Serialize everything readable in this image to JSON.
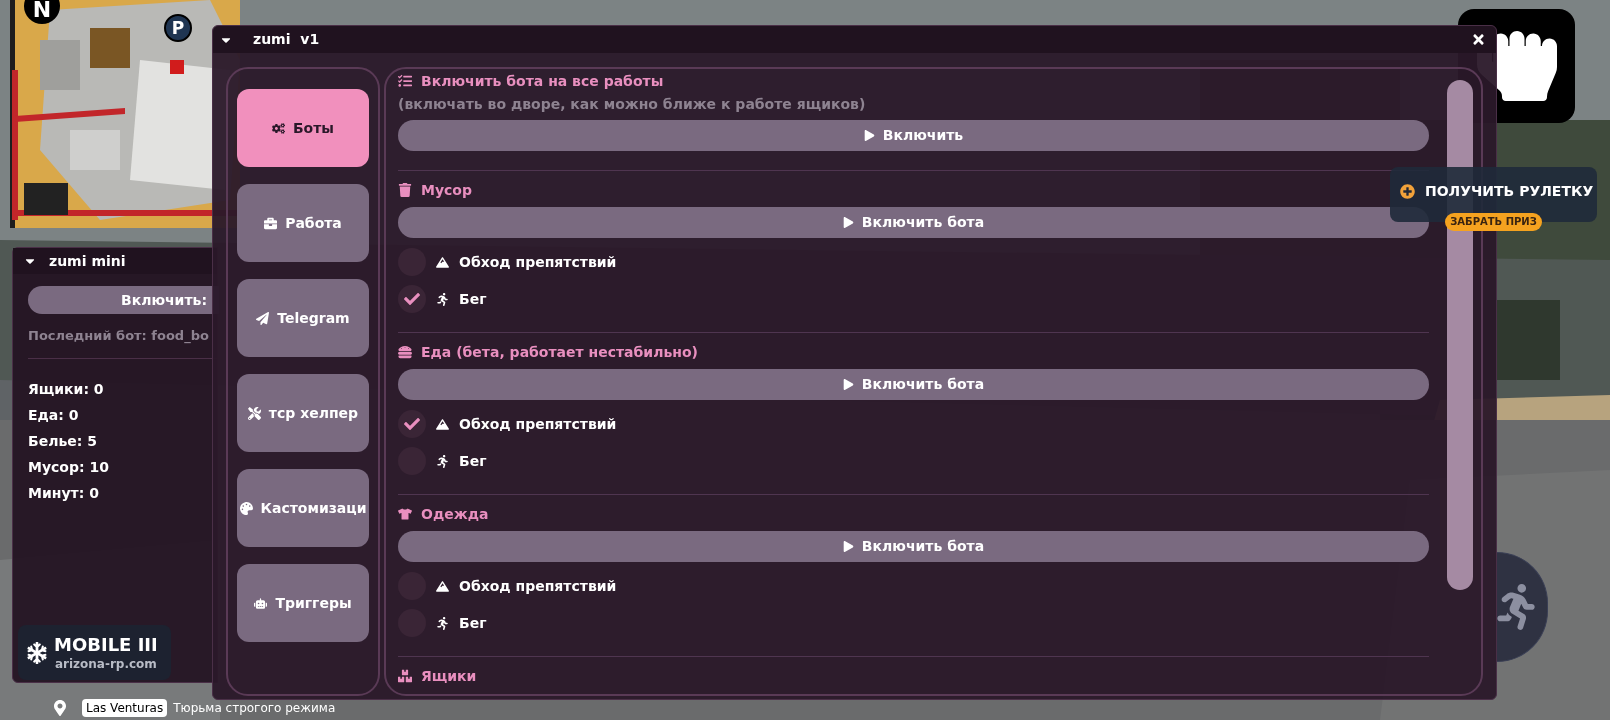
{
  "minimap": {
    "north": "N",
    "parking": "P"
  },
  "mini_window": {
    "title": "zumi mini",
    "button": "Включить:",
    "last_bot": "Последний бот: food_bo",
    "stats": [
      "Ящики: 0",
      "Еда: 0",
      "Белье: 5",
      "Мусор: 10",
      "Минут: 0"
    ]
  },
  "logo": {
    "title": "MOBILE III",
    "site": "arizona-rp.com"
  },
  "location": {
    "city": "Las Venturas",
    "zone": "Тюрьма строгого режима"
  },
  "roulette": {
    "title": "ПОЛУЧИТЬ РУЛЕТКУ",
    "badge": "ЗАБРАТЬ ПРИЗ"
  },
  "main_window": {
    "title": "zumi  v1",
    "tabs": [
      {
        "label": "Боты",
        "selected": true
      },
      {
        "label": "Работа",
        "selected": false
      },
      {
        "label": "Telegram",
        "selected": false
      },
      {
        "label": "тср хелпер",
        "selected": false
      },
      {
        "label": "Кастомизаци",
        "selected": false
      },
      {
        "label": "Триггеры",
        "selected": false
      }
    ],
    "sections": [
      {
        "title": "Включить бота на все работы",
        "note": "(включать во дворе, как можно ближе к работе ящиков)",
        "button": "Включить"
      },
      {
        "title": "Мусор",
        "button": "Включить бота",
        "options": [
          {
            "label": "Обход препятствий",
            "checked": false
          },
          {
            "label": "Бег",
            "checked": true
          }
        ]
      },
      {
        "title": "Еда (бета, работает нестабильно)",
        "button": "Включить бота",
        "options": [
          {
            "label": "Обход препятствий",
            "checked": true
          },
          {
            "label": "Бег",
            "checked": false
          }
        ]
      },
      {
        "title": "Одежда",
        "button": "Включить бота",
        "options": [
          {
            "label": "Обход препятствий",
            "checked": false
          },
          {
            "label": "Бег",
            "checked": false
          }
        ]
      },
      {
        "title": "Ящики"
      }
    ]
  }
}
